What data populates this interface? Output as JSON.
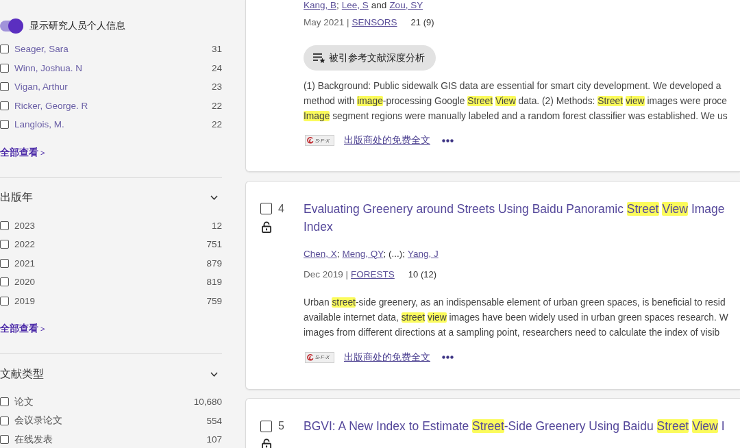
{
  "sidebar": {
    "sections": [
      {
        "kind": "researchers",
        "toggle": {
          "label": "显示研究人员个人信息",
          "on": true
        },
        "items": [
          {
            "label": "Seager, Sara",
            "count": "31",
            "checked": false
          },
          {
            "label": "Winn, Joshua. N",
            "count": "24",
            "checked": false
          },
          {
            "label": "Vigan, Arthur",
            "count": "23",
            "checked": false
          },
          {
            "label": "Ricker, George. R",
            "count": "22",
            "checked": false
          },
          {
            "label": "Langlois, M.",
            "count": "22",
            "checked": false
          }
        ],
        "see_all": {
          "label": "全部查看",
          "arrow": ">"
        }
      },
      {
        "kind": "values",
        "title": "出版年",
        "items": [
          {
            "label": "2023",
            "count": "12",
            "checked": false
          },
          {
            "label": "2022",
            "count": "751",
            "checked": false
          },
          {
            "label": "2021",
            "count": "879",
            "checked": false
          },
          {
            "label": "2020",
            "count": "819",
            "checked": false
          },
          {
            "label": "2019",
            "count": "759",
            "checked": false
          }
        ],
        "see_all": {
          "label": "全部查看",
          "arrow": ">"
        }
      },
      {
        "kind": "values",
        "title": "文献类型",
        "items": [
          {
            "label": "论文",
            "count": "10,680",
            "checked": false
          },
          {
            "label": "会议录论文",
            "count": "554",
            "checked": false
          },
          {
            "label": "在线发表",
            "count": "107",
            "checked": false
          }
        ]
      }
    ]
  },
  "results": [
    {
      "authors": [
        {
          "kind": "link",
          "text": "Kang, B"
        },
        {
          "kind": "separator",
          "text": ";"
        },
        {
          "kind": "link",
          "text": "Lee, S"
        },
        {
          "kind": "conjunction",
          "text": "and"
        },
        {
          "kind": "link",
          "text": "Zou, SY"
        }
      ],
      "date": "May 2021 |",
      "journal": "SENSORS",
      "citations": "21 (9)",
      "analysis_button": "被引参考文献深度分析",
      "abstract": [
        [
          {
            "text": "(1) Background: Public sidewalk GIS data are essential for smart city development. We developed a",
            "highlighted": false
          }
        ],
        [
          {
            "text": "method with ",
            "highlighted": false
          },
          {
            "text": "image",
            "highlighted": true
          },
          {
            "text": "-processing Google ",
            "highlighted": false
          },
          {
            "text": "Street",
            "highlighted": true
          },
          {
            "text": " View",
            "highlighted": true
          },
          {
            "text": " data. (2) Methods: ",
            "highlighted": false
          },
          {
            "text": "Street",
            "highlighted": true
          },
          {
            "text": " view",
            "highlighted": true
          },
          {
            "text": " images were proce",
            "highlighted": false
          }
        ],
        [
          {
            "text": "Image",
            "highlighted": true
          },
          {
            "text": " segment regions were manually labeled and a random forest classifier was established. We us",
            "highlighted": false
          }
        ]
      ],
      "links": {
        "logo": "S·F·X",
        "full_text": "出版商处的免费全文"
      }
    },
    {
      "number": "4",
      "checked": false,
      "open_access": true,
      "title": [
        [
          {
            "text": "Evaluating Greenery around Streets Using Baidu Panoramic ",
            "highlighted": false
          },
          {
            "text": "Street",
            "highlighted": true
          },
          {
            "text": " View",
            "highlighted": true
          },
          {
            "text": " Image",
            "highlighted": false
          }
        ],
        [
          {
            "text": "Index",
            "highlighted": false
          }
        ]
      ],
      "authors": [
        {
          "kind": "link",
          "text": "Chen, X"
        },
        {
          "kind": "separator",
          "text": ";"
        },
        {
          "kind": "link",
          "text": "Meng, QY"
        },
        {
          "kind": "separator",
          "text": "; (...);"
        },
        {
          "kind": "link",
          "text": "Yang, J"
        }
      ],
      "date": "Dec 2019 |",
      "journal": "FORESTS",
      "citations": "10 (12)",
      "abstract": [
        [
          {
            "text": "Urban ",
            "highlighted": false
          },
          {
            "text": "street",
            "highlighted": true
          },
          {
            "text": "-side greenery, as an indispensable element of urban green spaces, is beneficial to resid",
            "highlighted": false
          }
        ],
        [
          {
            "text": "available internet data, ",
            "highlighted": false
          },
          {
            "text": "street",
            "highlighted": true
          },
          {
            "text": " view",
            "highlighted": true
          },
          {
            "text": " images have been widely used in urban green spaces research. W",
            "highlighted": false
          }
        ],
        [
          {
            "text": "images from different directions at a sampling point, researchers need to calculate the index of visib",
            "highlighted": false
          }
        ]
      ],
      "links": {
        "logo": "S·F·X",
        "full_text": "出版商处的免费全文"
      }
    },
    {
      "number": "5",
      "checked": false,
      "open_access": true,
      "title": [
        [
          {
            "text": "BGVI: A New Index to Estimate ",
            "highlighted": false
          },
          {
            "text": "Street",
            "highlighted": true
          },
          {
            "text": "-Side Greenery Using Baidu ",
            "highlighted": false
          },
          {
            "text": "Street",
            "highlighted": true
          },
          {
            "text": " View",
            "highlighted": true
          },
          {
            "text": " I",
            "highlighted": false
          }
        ]
      ]
    }
  ]
}
